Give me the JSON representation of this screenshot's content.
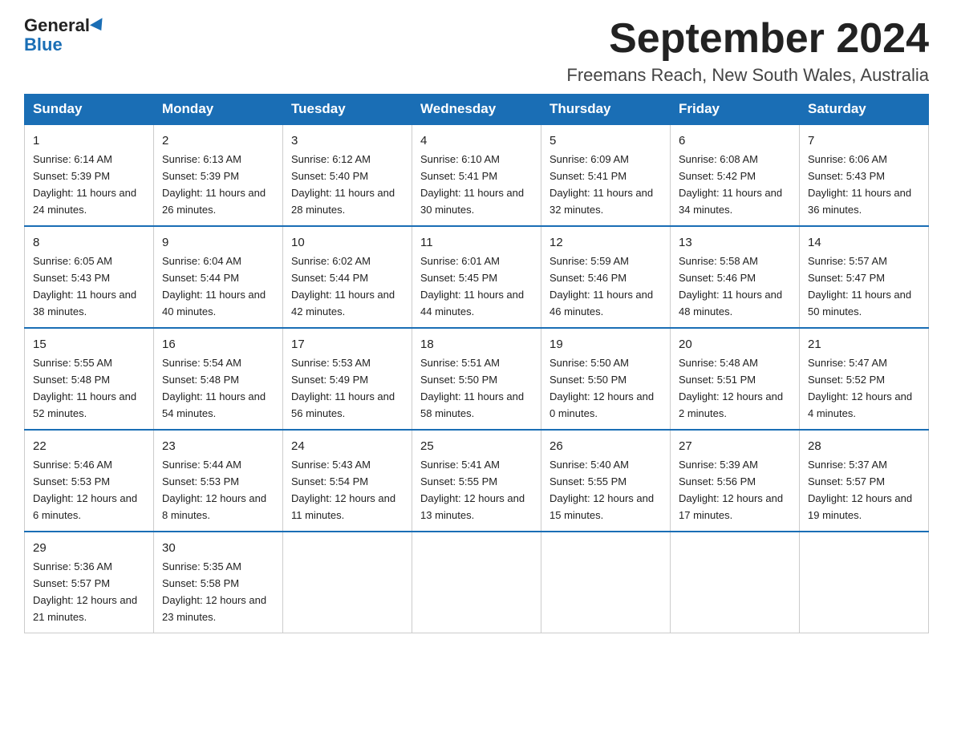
{
  "logo": {
    "general": "General",
    "blue": "Blue"
  },
  "title": {
    "month_year": "September 2024",
    "location": "Freemans Reach, New South Wales, Australia"
  },
  "headers": [
    "Sunday",
    "Monday",
    "Tuesday",
    "Wednesday",
    "Thursday",
    "Friday",
    "Saturday"
  ],
  "weeks": [
    [
      {
        "day": "1",
        "sunrise": "6:14 AM",
        "sunset": "5:39 PM",
        "daylight": "11 hours and 24 minutes."
      },
      {
        "day": "2",
        "sunrise": "6:13 AM",
        "sunset": "5:39 PM",
        "daylight": "11 hours and 26 minutes."
      },
      {
        "day": "3",
        "sunrise": "6:12 AM",
        "sunset": "5:40 PM",
        "daylight": "11 hours and 28 minutes."
      },
      {
        "day": "4",
        "sunrise": "6:10 AM",
        "sunset": "5:41 PM",
        "daylight": "11 hours and 30 minutes."
      },
      {
        "day": "5",
        "sunrise": "6:09 AM",
        "sunset": "5:41 PM",
        "daylight": "11 hours and 32 minutes."
      },
      {
        "day": "6",
        "sunrise": "6:08 AM",
        "sunset": "5:42 PM",
        "daylight": "11 hours and 34 minutes."
      },
      {
        "day": "7",
        "sunrise": "6:06 AM",
        "sunset": "5:43 PM",
        "daylight": "11 hours and 36 minutes."
      }
    ],
    [
      {
        "day": "8",
        "sunrise": "6:05 AM",
        "sunset": "5:43 PM",
        "daylight": "11 hours and 38 minutes."
      },
      {
        "day": "9",
        "sunrise": "6:04 AM",
        "sunset": "5:44 PM",
        "daylight": "11 hours and 40 minutes."
      },
      {
        "day": "10",
        "sunrise": "6:02 AM",
        "sunset": "5:44 PM",
        "daylight": "11 hours and 42 minutes."
      },
      {
        "day": "11",
        "sunrise": "6:01 AM",
        "sunset": "5:45 PM",
        "daylight": "11 hours and 44 minutes."
      },
      {
        "day": "12",
        "sunrise": "5:59 AM",
        "sunset": "5:46 PM",
        "daylight": "11 hours and 46 minutes."
      },
      {
        "day": "13",
        "sunrise": "5:58 AM",
        "sunset": "5:46 PM",
        "daylight": "11 hours and 48 minutes."
      },
      {
        "day": "14",
        "sunrise": "5:57 AM",
        "sunset": "5:47 PM",
        "daylight": "11 hours and 50 minutes."
      }
    ],
    [
      {
        "day": "15",
        "sunrise": "5:55 AM",
        "sunset": "5:48 PM",
        "daylight": "11 hours and 52 minutes."
      },
      {
        "day": "16",
        "sunrise": "5:54 AM",
        "sunset": "5:48 PM",
        "daylight": "11 hours and 54 minutes."
      },
      {
        "day": "17",
        "sunrise": "5:53 AM",
        "sunset": "5:49 PM",
        "daylight": "11 hours and 56 minutes."
      },
      {
        "day": "18",
        "sunrise": "5:51 AM",
        "sunset": "5:50 PM",
        "daylight": "11 hours and 58 minutes."
      },
      {
        "day": "19",
        "sunrise": "5:50 AM",
        "sunset": "5:50 PM",
        "daylight": "12 hours and 0 minutes."
      },
      {
        "day": "20",
        "sunrise": "5:48 AM",
        "sunset": "5:51 PM",
        "daylight": "12 hours and 2 minutes."
      },
      {
        "day": "21",
        "sunrise": "5:47 AM",
        "sunset": "5:52 PM",
        "daylight": "12 hours and 4 minutes."
      }
    ],
    [
      {
        "day": "22",
        "sunrise": "5:46 AM",
        "sunset": "5:53 PM",
        "daylight": "12 hours and 6 minutes."
      },
      {
        "day": "23",
        "sunrise": "5:44 AM",
        "sunset": "5:53 PM",
        "daylight": "12 hours and 8 minutes."
      },
      {
        "day": "24",
        "sunrise": "5:43 AM",
        "sunset": "5:54 PM",
        "daylight": "12 hours and 11 minutes."
      },
      {
        "day": "25",
        "sunrise": "5:41 AM",
        "sunset": "5:55 PM",
        "daylight": "12 hours and 13 minutes."
      },
      {
        "day": "26",
        "sunrise": "5:40 AM",
        "sunset": "5:55 PM",
        "daylight": "12 hours and 15 minutes."
      },
      {
        "day": "27",
        "sunrise": "5:39 AM",
        "sunset": "5:56 PM",
        "daylight": "12 hours and 17 minutes."
      },
      {
        "day": "28",
        "sunrise": "5:37 AM",
        "sunset": "5:57 PM",
        "daylight": "12 hours and 19 minutes."
      }
    ],
    [
      {
        "day": "29",
        "sunrise": "5:36 AM",
        "sunset": "5:57 PM",
        "daylight": "12 hours and 21 minutes."
      },
      {
        "day": "30",
        "sunrise": "5:35 AM",
        "sunset": "5:58 PM",
        "daylight": "12 hours and 23 minutes."
      },
      null,
      null,
      null,
      null,
      null
    ]
  ],
  "labels": {
    "sunrise_prefix": "Sunrise: ",
    "sunset_prefix": "Sunset: ",
    "daylight_prefix": "Daylight: "
  }
}
